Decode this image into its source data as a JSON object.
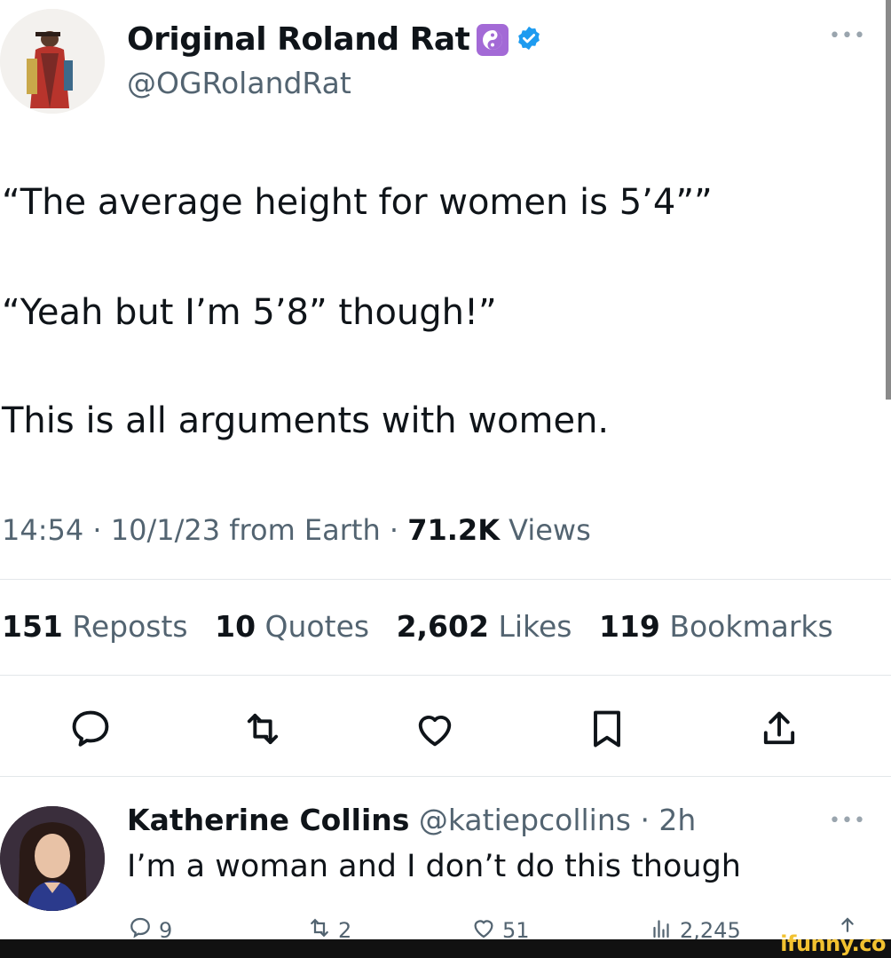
{
  "tweet": {
    "author": {
      "display_name": "Original Roland Rat",
      "handle": "@OGRolandRat",
      "verified_icon": "verified-badge-icon",
      "emoji_badge_icon": "yin-yang-icon"
    },
    "lines": [
      "“The average height for women is 5’4””",
      "“Yeah but I’m 5’8” though!”",
      "This is all arguments with women."
    ],
    "meta": {
      "time_date": "14:54 · 10/1/23 from Earth ·",
      "views_count": "71.2K",
      "views_label": "Views"
    },
    "stats": [
      {
        "count": "151",
        "label": "Reposts"
      },
      {
        "count": "10",
        "label": "Quotes"
      },
      {
        "count": "2,602",
        "label": "Likes"
      },
      {
        "count": "119",
        "label": "Bookmarks"
      }
    ],
    "actions": [
      "reply-icon",
      "repost-icon",
      "like-icon",
      "bookmark-icon",
      "share-icon"
    ]
  },
  "reply": {
    "display_name": "Katherine Collins",
    "handle_time": "@katiepcollins · 2h",
    "text": "I’m a woman and I don’t do this though",
    "actions": [
      {
        "icon": "reply-icon",
        "count": "9"
      },
      {
        "icon": "repost-icon",
        "count": "2"
      },
      {
        "icon": "like-icon",
        "count": "51"
      },
      {
        "icon": "views-icon",
        "count": "2,245"
      },
      {
        "icon": "share-icon",
        "count": ""
      }
    ]
  },
  "watermark": "ifunny.co",
  "colors": {
    "text": "#0f1419",
    "secondary": "#536471",
    "verified": "#1d9bf0",
    "badge": "#a36ad6"
  }
}
